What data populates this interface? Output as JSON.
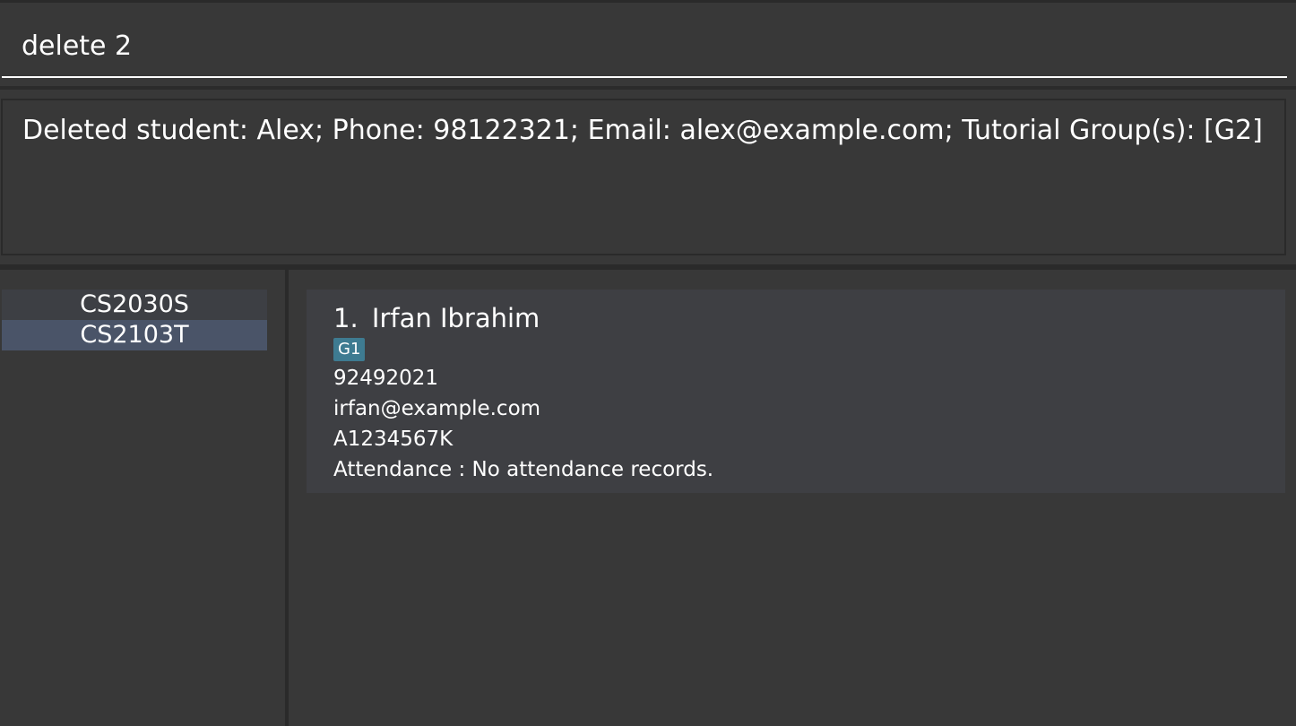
{
  "command_box": {
    "value": "delete 2"
  },
  "result_display": {
    "text": "Deleted student: Alex; Phone: 98122321; Email: alex@example.com; Tutorial Group(s): [G2]"
  },
  "modules": [
    {
      "code": "CS2030S",
      "selected": false
    },
    {
      "code": "CS2103T",
      "selected": true
    }
  ],
  "students": [
    {
      "index": "1.",
      "name": "Irfan Ibrahim",
      "tags": [
        "G1"
      ],
      "phone": "92492021",
      "email": "irfan@example.com",
      "student_id": "A1234567K",
      "attendance": "Attendance : No attendance records."
    }
  ],
  "colors": {
    "background": "#383838",
    "selected_module": "#4a5468",
    "card": "#3e3f43",
    "tag": "#3e7b91"
  }
}
